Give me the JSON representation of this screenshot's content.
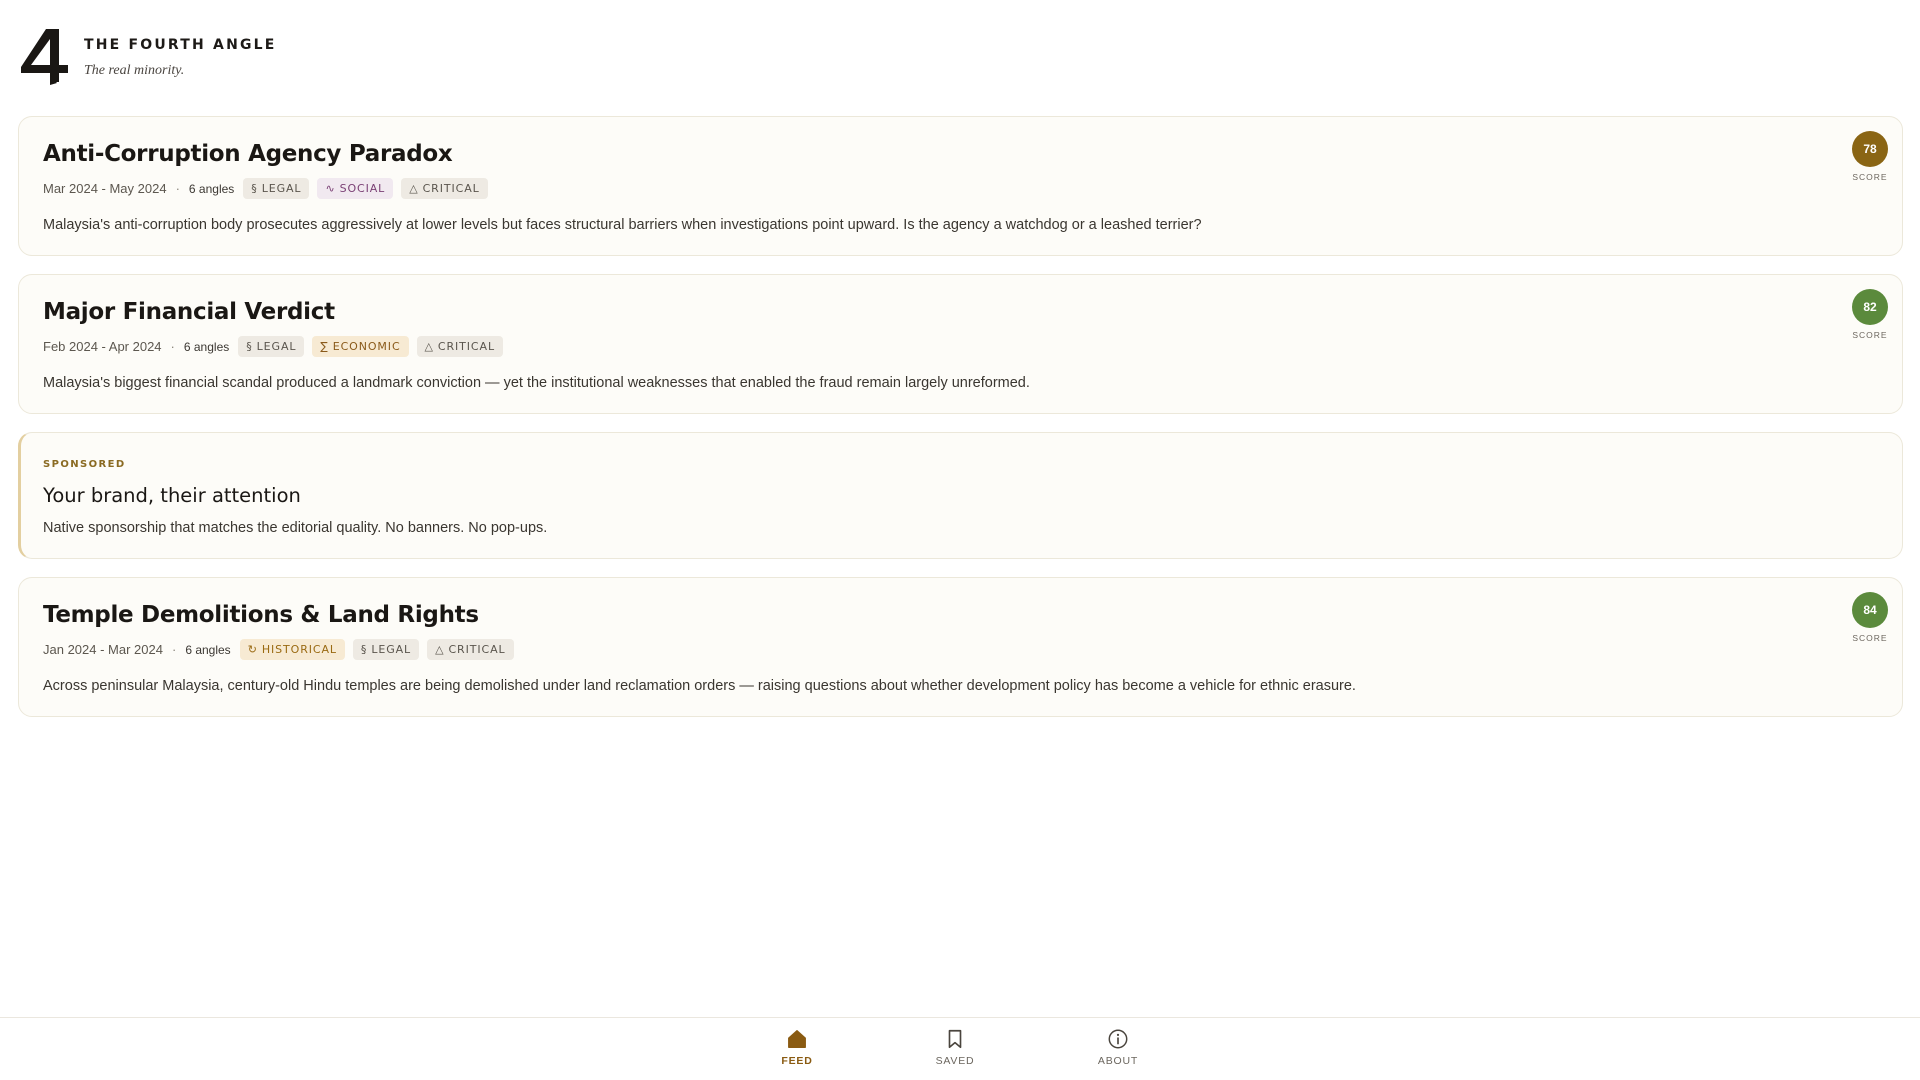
{
  "app": {
    "logo_icon": "four-angle-logo-icon",
    "name": "THE FOURTH ANGLE",
    "tagline": "The real minority."
  },
  "colors": {
    "accent": "#8a5b12",
    "score_amber": "#8a6514",
    "score_green": "#5b8a3c",
    "card_background": "#fdfcf8"
  },
  "feed": [
    {
      "title": "Anti-Corruption Agency Paradox",
      "date_range": "Mar 2024 - May 2024",
      "separator": "·",
      "angles": "6 angles",
      "tags": [
        {
          "icon": "§",
          "label": "LEGAL",
          "type": "legal"
        },
        {
          "icon": "∿",
          "label": "SOCIAL",
          "type": "social"
        },
        {
          "icon": "△",
          "label": "CRITICAL",
          "type": "critical"
        }
      ],
      "summary": "Malaysia's anti-corruption body prosecutes aggressively at lower levels but faces structural barriers when investigations point upward. Is the agency a watchdog or a leashed terrier?",
      "score": "78",
      "score_label": "SCORE",
      "score_color": "#8a6514"
    },
    {
      "title": "Major Financial Verdict",
      "date_range": "Feb 2024 - Apr 2024",
      "separator": "·",
      "angles": "6 angles",
      "tags": [
        {
          "icon": "§",
          "label": "LEGAL",
          "type": "legal"
        },
        {
          "icon": "∑",
          "label": "ECONOMIC",
          "type": "economic"
        },
        {
          "icon": "△",
          "label": "CRITICAL",
          "type": "critical"
        }
      ],
      "summary": "Malaysia's biggest financial scandal produced a landmark conviction — yet the institutional weaknesses that enabled the fraud remain largely unreformed.",
      "score": "82",
      "score_label": "SCORE",
      "score_color": "#5b8a3c"
    },
    {
      "title": "Temple Demolitions & Land Rights",
      "date_range": "Jan 2024 - Mar 2024",
      "separator": "·",
      "angles": "6 angles",
      "tags": [
        {
          "icon": "↻",
          "label": "HISTORICAL",
          "type": "historical"
        },
        {
          "icon": "§",
          "label": "LEGAL",
          "type": "legal"
        },
        {
          "icon": "△",
          "label": "CRITICAL",
          "type": "critical"
        }
      ],
      "summary": "Across peninsular Malaysia, century-old Hindu temples are being demolished under land reclamation orders — raising questions about whether development policy has become a vehicle for ethnic erasure.",
      "score": "84",
      "score_label": "SCORE",
      "score_color": "#5b8a3c"
    }
  ],
  "sponsored": {
    "label": "SPONSORED",
    "title": "Your brand, their attention",
    "text": "Native sponsorship that matches the editorial quality. No banners. No pop-ups."
  },
  "nav": {
    "feed": {
      "label": "FEED",
      "icon": "home-icon",
      "active": true
    },
    "saved": {
      "label": "SAVED",
      "icon": "bookmark-icon",
      "active": false
    },
    "about": {
      "label": "ABOUT",
      "icon": "info-icon",
      "active": false
    }
  }
}
